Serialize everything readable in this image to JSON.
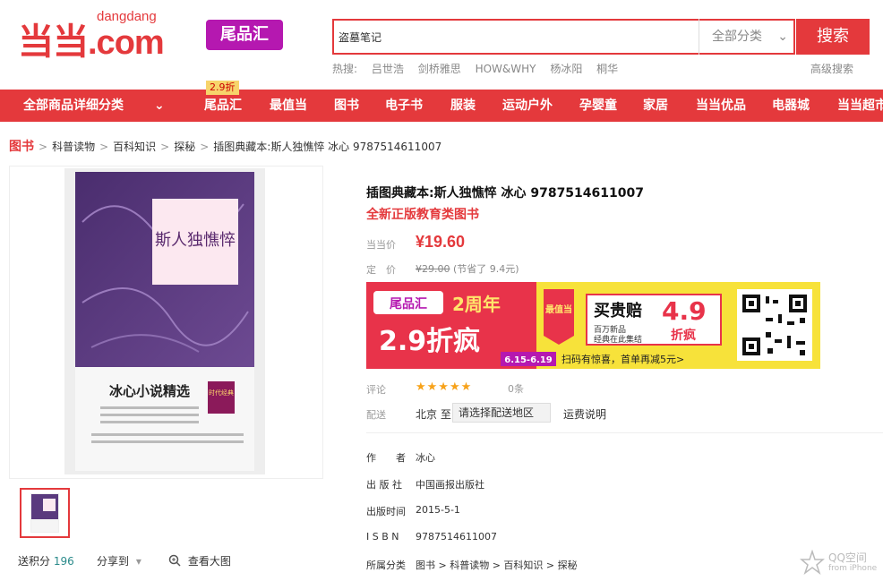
{
  "header": {
    "logo_main": "当当",
    "logo_domain": "dangdang",
    "logo_com": ".com",
    "tag_label": "尾品汇",
    "search_value": "盗墓笔记",
    "category_select": "全部分类",
    "search_button": "搜索",
    "hot_label": "热搜:",
    "hot_terms": [
      "吕世浩",
      "剑桥雅思",
      "HOW&WHY",
      "杨冰阳",
      "桐华"
    ],
    "advanced_search": "高级搜索"
  },
  "nav": {
    "all_label": "全部商品详细分类",
    "badge": "2.9折",
    "items": [
      "尾品汇",
      "最值当",
      "图书",
      "电子书",
      "服装",
      "运动户外",
      "孕婴童",
      "家居",
      "当当优品",
      "电器城",
      "当当超市"
    ]
  },
  "breadcrumb": [
    "图书",
    "科普读物",
    "百科知识",
    "探秘",
    "插图典藏本:斯人独憔悴 冰心 9787514611007"
  ],
  "gallery": {
    "book_series": "冰心小说精选",
    "book_title": "斯人独憔悴",
    "badge": "时代经典",
    "points_label": "送积分",
    "points_value": "196",
    "share_label": "分享到",
    "zoom_label": "查看大图"
  },
  "product": {
    "title": "插图典藏本:斯人独憔悴 冰心 9787514611007",
    "subtitle": "全新正版教育类图书",
    "price_label": "当当价",
    "price": "¥19.60",
    "orig_label": "定　价",
    "orig_price": "¥29.00",
    "saving": "(节省了 9.4元)",
    "review_label": "评论",
    "stars": "★★★★★",
    "review_count": "0条",
    "ship_label": "配送",
    "ship_from": "北京 至",
    "ship_select": "请选择配送地区",
    "ship_fee": "运费说明"
  },
  "banner": {
    "tag": "尾品汇",
    "anniv": "2周年",
    "discount": "2.9折疯",
    "dates": "6.15-6.19",
    "best_tag": "最值当",
    "promise": "买贵赔",
    "promise_disc": "4.9",
    "promise_disc2": "折疯",
    "small1": "百万新品",
    "small2": "经典在此集结",
    "scan": "扫码有惊喜，首单再减5元>"
  },
  "meta": [
    {
      "label": "作　　者",
      "value": "冰心"
    },
    {
      "label": "出 版 社",
      "value": "中国画报出版社"
    },
    {
      "label": "出版时间",
      "value": "2015-5-1"
    },
    {
      "label": "I S B N",
      "value": "9787514611007"
    },
    {
      "label": "所属分类",
      "value": "图书 > 科普读物 > 百科知识 > 探秘"
    }
  ],
  "watermark": {
    "line1": "QQ空间",
    "line2": "from iPhone"
  },
  "colors": {
    "accent": "#e4393c",
    "tag_purple": "#b518b0",
    "banner_yellow": "#f7e23a"
  }
}
